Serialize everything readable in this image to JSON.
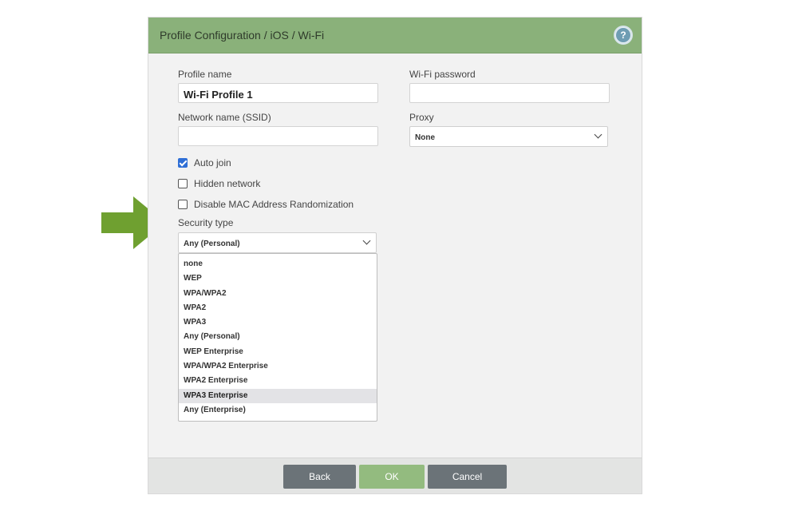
{
  "dialog": {
    "title": "Profile Configuration / iOS / Wi-Fi",
    "help_symbol": "?"
  },
  "form": {
    "profile_name": {
      "label": "Profile name",
      "value": "Wi-Fi Profile 1"
    },
    "wifi_password": {
      "label": "Wi-Fi password",
      "value": ""
    },
    "ssid": {
      "label": "Network name (SSID)",
      "value": ""
    },
    "proxy": {
      "label": "Proxy",
      "value": "None"
    },
    "auto_join": {
      "label": "Auto join",
      "checked": true
    },
    "hidden_network": {
      "label": "Hidden network",
      "checked": false
    },
    "disable_mac": {
      "label": "Disable MAC Address Randomization",
      "checked": false
    },
    "security_type": {
      "label": "Security type",
      "value": "Any (Personal)",
      "options": [
        "none",
        "WEP",
        "WPA/WPA2",
        "WPA2",
        "WPA3",
        "Any (Personal)",
        "WEP Enterprise",
        "WPA/WPA2 Enterprise",
        "WPA2 Enterprise",
        "WPA3 Enterprise",
        "Any (Enterprise)"
      ],
      "highlighted": "WPA3 Enterprise"
    }
  },
  "footer": {
    "back": "Back",
    "ok": "OK",
    "cancel": "Cancel"
  },
  "colors": {
    "header": "#8ab17a",
    "arrow": "#6fa030",
    "checkbox": "#2f6fd6"
  },
  "icons": [
    "help-icon",
    "chevron-down-icon",
    "checkmark-icon",
    "right-arrow-icon"
  ]
}
